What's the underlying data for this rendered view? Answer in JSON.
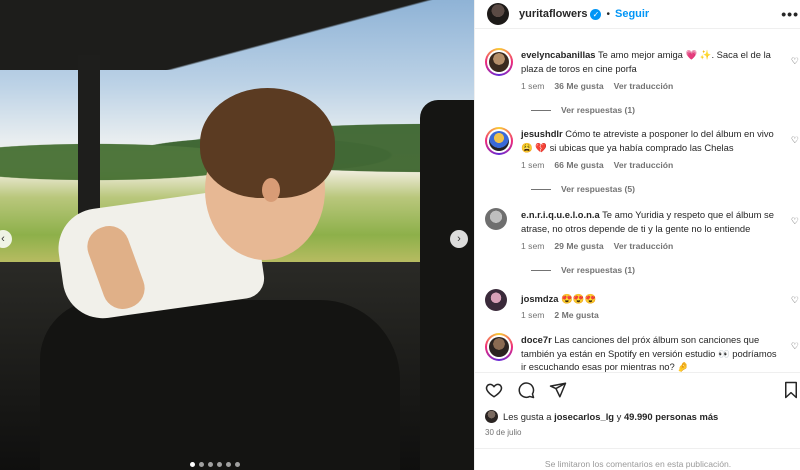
{
  "post": {
    "author": "yuritaflowers",
    "verified_glyph": "✓",
    "separator": "•",
    "follow_label": "Seguir",
    "more_label": "•••"
  },
  "photo": {
    "nav_prev": "‹",
    "nav_next": "›",
    "carousel_dots": 6,
    "active_dot": 0
  },
  "comments": [
    {
      "username": "evelyncabanillas",
      "text_before": "Te amo mejor amiga",
      "emoji": "💗 ✨",
      "text_after": ". Saca el de la plaza de toros en cine porfa",
      "time": "1 sem",
      "likes": "36 Me gusta",
      "translate": "Ver traducción",
      "replies": "Ver respuestas (1)"
    },
    {
      "username": "jesushdlr",
      "text_before": "Cómo te atreviste a posponer lo del álbum en vivo",
      "emoji": "😩 💔",
      "text_after": "si ubicas que ya había comprado las Chelas",
      "time": "1 sem",
      "likes": "66 Me gusta",
      "translate": "Ver traducción",
      "replies": "Ver respuestas (5)"
    },
    {
      "username": "e.n.r.i.q.u.e.l.o.n.a",
      "text_before": "Te amo Yuridia y respeto que el álbum se atrase, no otros depende de ti y la gente no lo entiende",
      "emoji": "",
      "text_after": "",
      "time": "1 sem",
      "likes": "29 Me gusta",
      "translate": "Ver traducción",
      "replies": "Ver respuestas (1)"
    },
    {
      "username": "josmdza",
      "text_before": "",
      "emoji": "😍😍😍",
      "text_after": "",
      "time": "1 sem",
      "likes": "2 Me gusta",
      "translate": "",
      "replies": ""
    },
    {
      "username": "doce7r",
      "text_before": "Las canciones del próx álbum son canciones que también ya están en Spotify en versión estudio",
      "emoji": "👀",
      "text_after": "podríamos ir escuchando esas por mientras no?",
      "emoji2": "🤌",
      "time": "",
      "likes": "",
      "translate": "",
      "replies": ""
    }
  ],
  "actions": {
    "like_icon": "heart-outline",
    "comment_icon": "comment-bubble",
    "share_icon": "paper-plane",
    "save_icon": "bookmark"
  },
  "likes": {
    "prefix": "Les gusta a",
    "user": "josecarlos_lg",
    "middle": "y",
    "count": "49.990 personas más"
  },
  "date": "30 de julio",
  "footer": "Se limitaron los comentarios en esta publicación."
}
